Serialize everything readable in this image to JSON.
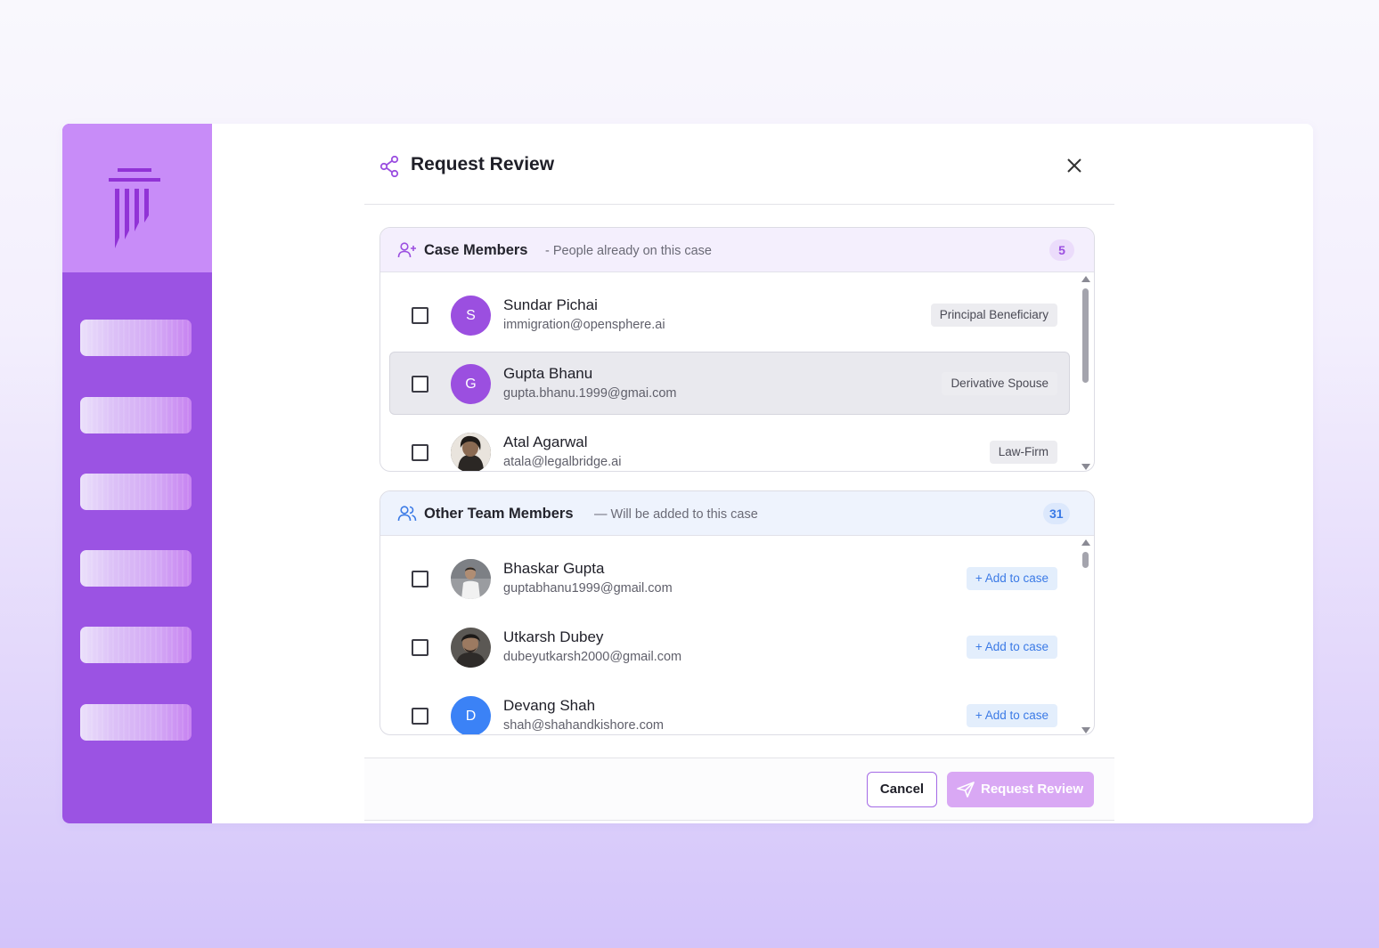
{
  "dialog": {
    "title": "Request Review",
    "case_members": {
      "title": "Case Members",
      "subtitle": "- People already on this case",
      "count": "5",
      "members": [
        {
          "initial": "S",
          "name": "Sundar Pichai",
          "email": "immigration@opensphere.ai",
          "role": "Principal Beneficiary",
          "avatar_color": "#9b4fe0"
        },
        {
          "initial": "G",
          "name": "Gupta Bhanu",
          "email": "gupta.bhanu.1999@gmai.com",
          "role": "Derivative Spouse",
          "avatar_color": "#9b4fe0"
        },
        {
          "initial": "",
          "name": "Atal Agarwal",
          "email": "atala@legalbridge.ai",
          "role": "Law-Firm",
          "avatar_color": "#2d2a28"
        }
      ]
    },
    "other_members": {
      "title": "Other Team Members",
      "subtitle": "— Will be added to this case",
      "count": "31",
      "add_label": "+ Add to case",
      "members": [
        {
          "initial": "",
          "name": "Bhaskar Gupta",
          "email": "guptabhanu1999@gmail.com",
          "avatar_color": "#8d8f93"
        },
        {
          "initial": "",
          "name": "Utkarsh Dubey",
          "email": "dubeyutkarsh2000@gmail.com",
          "avatar_color": "#3f3c39"
        },
        {
          "initial": "D",
          "name": "Devang Shah",
          "email": "shah@shahandkishore.com",
          "avatar_color": "#3b82f6"
        }
      ]
    },
    "footer": {
      "cancel_label": "Cancel",
      "request_label": "Request Review"
    }
  },
  "colors": {
    "brand_purple": "#9b53e3",
    "accent_blue": "#3b7ae6"
  },
  "icons": [
    "logo-pillar-icon",
    "share-icon",
    "close-icon",
    "user-plus-icon",
    "users-icon",
    "send-icon"
  ]
}
